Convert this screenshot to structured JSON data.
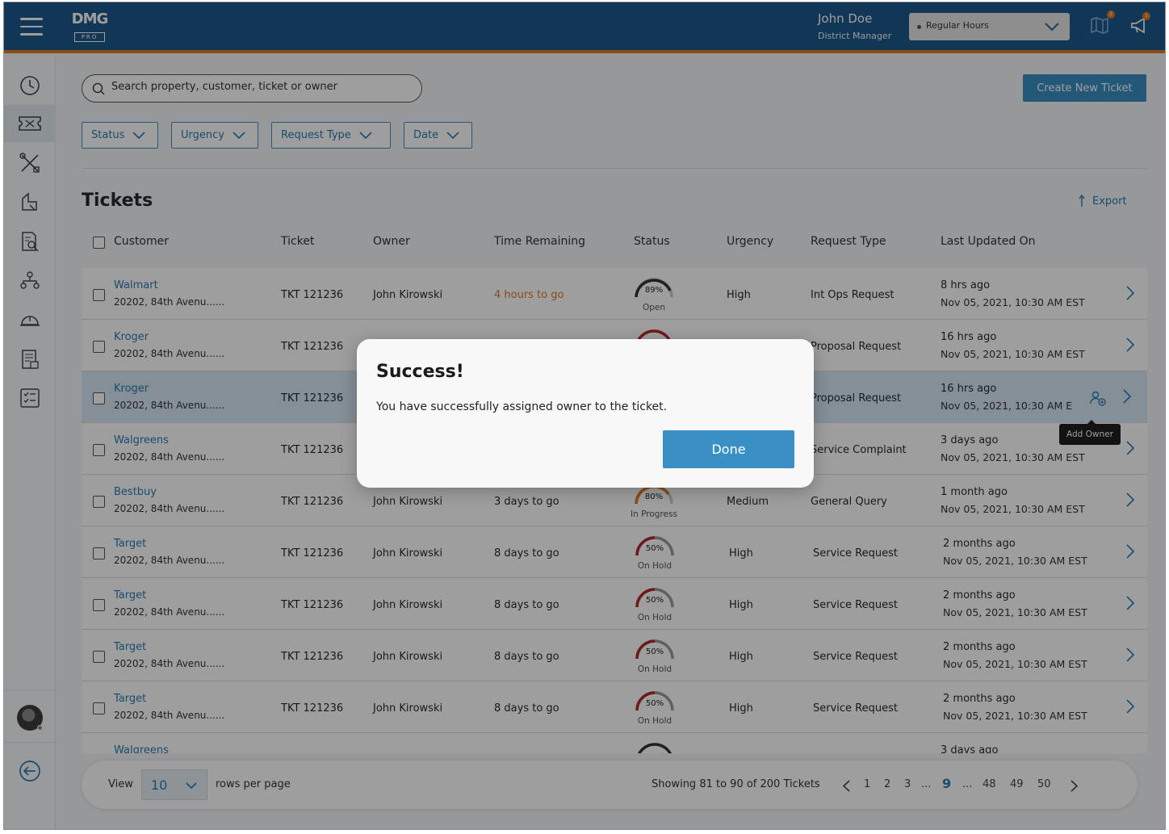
{
  "header": {
    "logo_main": "DMG",
    "logo_sub": "PRO",
    "user_name": "John Doe",
    "user_role": "District Manager",
    "hours_select": "Regular Hours",
    "map_badge": "2",
    "announce_badge": "1"
  },
  "search": {
    "placeholder": "Search property, customer, ticket or owner"
  },
  "create_button": "Create New Ticket",
  "filters": [
    "Status",
    "Urgency",
    "Request Type",
    "Date"
  ],
  "page_title": "Tickets",
  "export_label": "Export",
  "columns": [
    "Customer",
    "Ticket",
    "Owner",
    "Time Remaining",
    "Status",
    "Urgency",
    "Request Type",
    "Last Updated On"
  ],
  "rows": [
    {
      "customer": "Walmart",
      "address": "20202, 84th Avenu......",
      "ticket": "TKT 121236",
      "owner": "John Kirowski",
      "time": "4 hours to go",
      "pct": "89%",
      "status": "Open",
      "urgency": "High",
      "type": "Int Ops Request",
      "ago": "8 hrs ago",
      "date": "Nov 05, 2021, 10:30 AM EST"
    },
    {
      "customer": "Kroger",
      "address": "20202, 84th Avenu......",
      "ticket": "TKT 121236",
      "owner": "",
      "time": "",
      "pct": "",
      "status": "",
      "urgency": "",
      "type": "Proposal Request",
      "ago": "16 hrs ago",
      "date": "Nov 05, 2021, 10:30 AM EST"
    },
    {
      "customer": "Kroger",
      "address": "20202, 84th Avenu......",
      "ticket": "TKT 121236",
      "owner": "",
      "time": "",
      "pct": "",
      "status": "",
      "urgency": "",
      "type": "Proposal Request",
      "ago": "16 hrs ago",
      "date": "Nov 05, 2021, 10:30 AM E"
    },
    {
      "customer": "Walgreens",
      "address": "20202, 84th Avenu......",
      "ticket": "TKT 121236",
      "owner": "",
      "time": "",
      "pct": "",
      "status": "",
      "urgency": "",
      "type": "Service Complaint",
      "ago": "3 days ago",
      "date": "Nov 05, 2021, 10:30 AM EST"
    },
    {
      "customer": "Bestbuy",
      "address": "20202, 84th Avenu......",
      "ticket": "TKT 121236",
      "owner": "John Kirowski",
      "time": "3 days to go",
      "pct": "80%",
      "status": "In Progress",
      "urgency": "Medium",
      "type": "General Query",
      "ago": "1 month ago",
      "date": "Nov 05, 2021, 10:30 AM EST"
    },
    {
      "customer": "Target",
      "address": "20202, 84th Avenu......",
      "ticket": "TKT 121236",
      "owner": "John Kirowski",
      "time": "8 days to go",
      "pct": "50%",
      "status": "On Hold",
      "urgency": "High",
      "type": "Service Request",
      "ago": "2 months ago",
      "date": "Nov 05, 2021, 10:30 AM EST"
    },
    {
      "customer": "Target",
      "address": "20202, 84th Avenu......",
      "ticket": "TKT 121236",
      "owner": "John Kirowski",
      "time": "8 days to go",
      "pct": "50%",
      "status": "On Hold",
      "urgency": "High",
      "type": "Service Request",
      "ago": "2 months ago",
      "date": "Nov 05, 2021, 10:30 AM EST"
    },
    {
      "customer": "Target",
      "address": "20202, 84th Avenu......",
      "ticket": "TKT 121236",
      "owner": "John Kirowski",
      "time": "8 days to go",
      "pct": "50%",
      "status": "On Hold",
      "urgency": "High",
      "type": "Service Request",
      "ago": "2 months ago",
      "date": "Nov 05, 2021, 10:30 AM EST"
    },
    {
      "customer": "Target",
      "address": "20202, 84th Avenu......",
      "ticket": "TKT 121236",
      "owner": "John Kirowski",
      "time": "8 days to go",
      "pct": "50%",
      "status": "On Hold",
      "urgency": "High",
      "type": "Service Request",
      "ago": "2 months ago",
      "date": "Nov 05, 2021, 10:30 AM EST"
    },
    {
      "customer": "Walgreens",
      "address": "",
      "ticket": "",
      "owner": "",
      "time": "",
      "pct": "",
      "status": "",
      "urgency": "",
      "type": "",
      "ago": "3 days ago",
      "date": ""
    }
  ],
  "tooltip": "Add Owner",
  "pagination": {
    "view": "View",
    "rows_value": "10",
    "rows_label": "rows per page",
    "showing": "Showing 81 to 90 of 200 Tickets",
    "pages": [
      "1",
      "2",
      "3",
      "...",
      "9",
      "...",
      "48",
      "49",
      "50"
    ],
    "current": "9"
  },
  "modal": {
    "title": "Success!",
    "message": "You have successfully assigned owner to the ticket.",
    "button": "Done"
  },
  "colors": {
    "header": "#1d5a8c",
    "accent": "#3a8fc4",
    "warning": "#e07b24",
    "gauge_open": "#333333",
    "gauge_hold": "#b22a2a",
    "gauge_progress": "#e07b24"
  }
}
